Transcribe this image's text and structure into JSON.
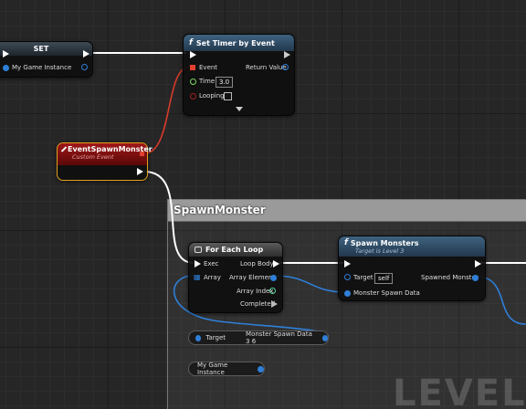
{
  "set_node": {
    "title": "SET",
    "pin_label": "My Game Instance"
  },
  "timer_node": {
    "title": "Set Timer by Event",
    "event_label": "Event",
    "return_label": "Return Value",
    "time_label": "Time",
    "time_value": "3.0",
    "looping_label": "Looping"
  },
  "event_node": {
    "title": "EventSpawnMonster",
    "subtitle": "Custom Event"
  },
  "comment": {
    "title": "SpawnMonster",
    "watermark": "LEVEL B"
  },
  "foreach_node": {
    "title": "For Each Loop",
    "exec_label": "Exec",
    "array_label": "Array",
    "loop_body_label": "Loop Body",
    "array_element_label": "Array Element",
    "array_index_label": "Array Index",
    "completed_label": "Completed"
  },
  "spawn_node": {
    "title": "Spawn Monsters",
    "subtitle": "Target is Level 3",
    "target_label": "Target",
    "target_value": "self",
    "spawned_label": "Spawned Monster",
    "data_label": "Monster Spawn Data"
  },
  "getter_node": {
    "target_label": "Target",
    "value_label": "Monster Spawn Data 3 6"
  },
  "instance_node": {
    "label": "My Game Instance"
  },
  "colors": {
    "exec_wire": "#ffffff",
    "delegate_wire": "#e04030",
    "object_wire": "#2f7fd8",
    "event_header": "#8a1010",
    "function_header": "#3a5a78",
    "macro_header": "#555555"
  }
}
